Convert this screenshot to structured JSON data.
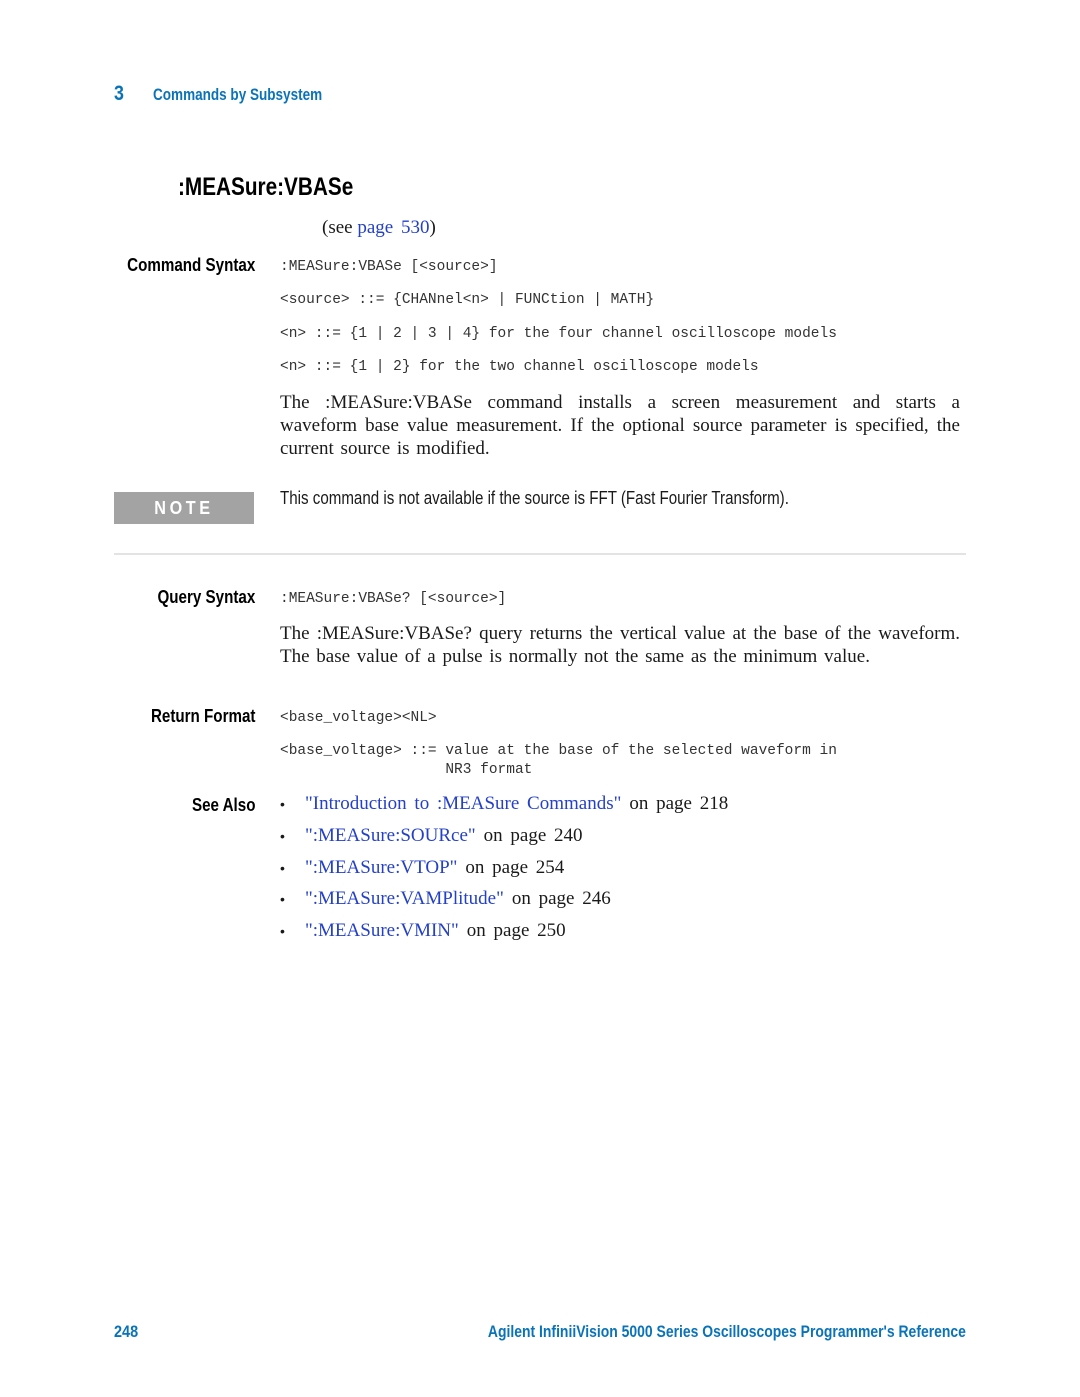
{
  "header": {
    "chapter_number": "3",
    "chapter_title": "Commands by Subsystem"
  },
  "section": {
    "title": ":MEASure:VBASe",
    "see_prefix": "(see ",
    "see_link": "page 530",
    "see_suffix": ")"
  },
  "command_syntax": {
    "label": "Command Syntax",
    "lines": [
      ":MEASure:VBASe [<source>]",
      "<source> ::= {CHANnel<n> | FUNCtion | MATH}",
      "<n> ::= {1 | 2 | 3 | 4} for the four channel oscilloscope models",
      "<n> ::= {1 | 2} for the two channel oscilloscope models"
    ],
    "description": "The :MEASure:VBASe command installs a screen measurement and starts a waveform base value measurement. If the optional source parameter is specified, the current source is modified."
  },
  "note": {
    "label": "NOTE",
    "text": "This command is not available if the source is FFT (Fast Fourier Transform)."
  },
  "query_syntax": {
    "label": "Query Syntax",
    "line": ":MEASure:VBASe? [<source>]",
    "description": "The :MEASure:VBASe? query returns the vertical value at the base of the waveform. The base value of a pulse is normally not the same as the minimum value."
  },
  "return_format": {
    "label": "Return Format",
    "lines": [
      "<base_voltage><NL>",
      "<base_voltage> ::= value at the base of the selected waveform in",
      "                   NR3 format"
    ]
  },
  "see_also": {
    "label": "See Also",
    "items": [
      {
        "link": "\"Introduction to :MEASure Commands\"",
        "suffix": "on page 218"
      },
      {
        "link": "\":MEASure:SOURce\"",
        "suffix": "on page 240"
      },
      {
        "link": "\":MEASure:VTOP\"",
        "suffix": "on page 254"
      },
      {
        "link": "\":MEASure:VAMPlitude\"",
        "suffix": "on page 246"
      },
      {
        "link": "\":MEASure:VMIN\"",
        "suffix": "on page 250"
      }
    ],
    "bullet": "•"
  },
  "footer": {
    "page_number": "248",
    "book_title": "Agilent InfiniiVision 5000 Series Oscilloscopes Programmer's Reference"
  },
  "colors": {
    "accent_blue": "#0a73b8",
    "link_blue": "#2440c8",
    "note_gray": "#a3a3a3"
  }
}
